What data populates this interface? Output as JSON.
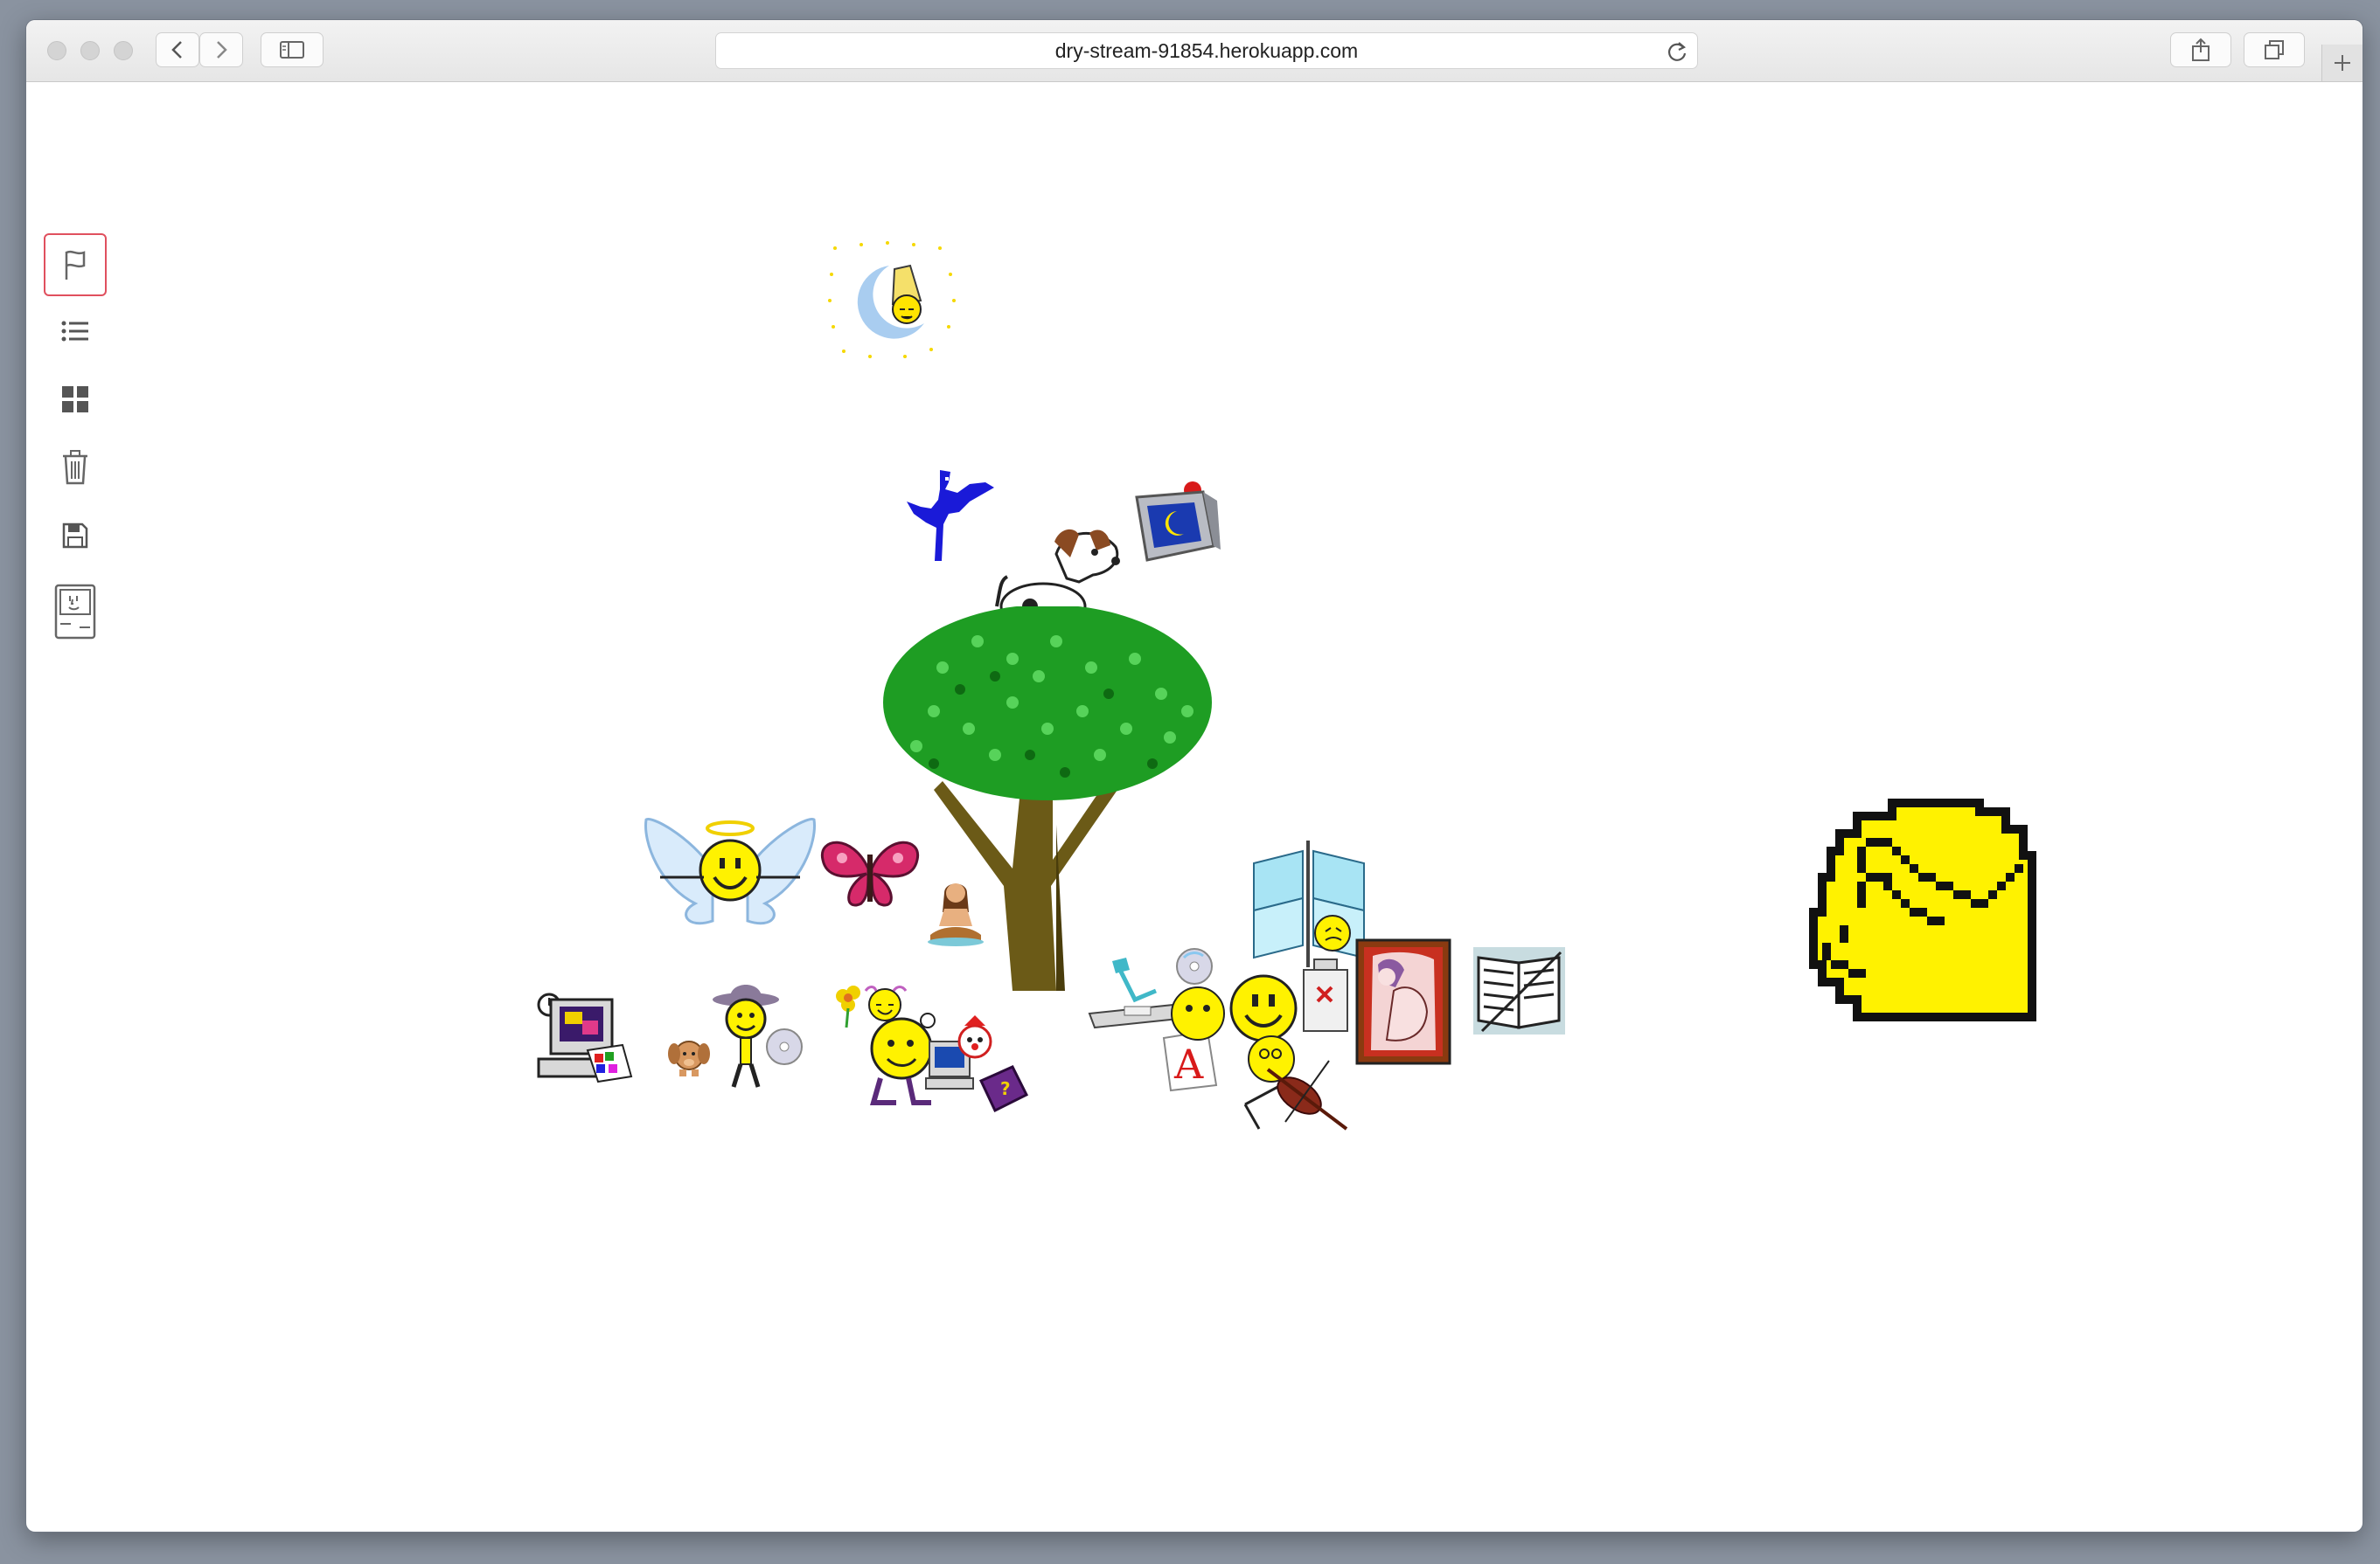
{
  "browser": {
    "url": "dry-stream-91854.herokuapp.com",
    "toolbar_icons": [
      "back-icon",
      "forward-icon",
      "sidebar-toggle-icon",
      "reload-icon",
      "share-icon",
      "tabs-overview-icon",
      "new-tab-icon"
    ]
  },
  "sidebar": {
    "active_tool": "flag",
    "tools": [
      {
        "name": "flag",
        "icon": "flag-icon"
      },
      {
        "name": "list",
        "icon": "list-icon"
      },
      {
        "name": "grid",
        "icon": "grid-icon"
      },
      {
        "name": "trash",
        "icon": "trash-icon"
      },
      {
        "name": "save",
        "icon": "save-icon"
      },
      {
        "name": "mac",
        "icon": "classic-mac-icon"
      }
    ]
  },
  "stickers": [
    "sleeping-moon",
    "blue-bird",
    "dog",
    "tv-moon",
    "tree",
    "angel-smiley",
    "butterfly",
    "meditating-woman",
    "computer-palette",
    "small-dog",
    "cowboy-smiley",
    "flower-smiley",
    "cd",
    "smiley-flower-hair",
    "computer-smiley",
    "clown",
    "purple-book",
    "desk-lamp",
    "letter-a",
    "cd-smiley",
    "big-smiley",
    "violin-smiley",
    "windmill",
    "smiley-bottle",
    "framed-painting",
    "book-pattern",
    "pixel-fist"
  ],
  "colors": {
    "sidebar_active_border": "#e0505e",
    "tree_leaves": "#1e9d23",
    "tree_trunk": "#6b5a17",
    "bird": "#1a1ad8",
    "smiley_yellow": "#fff200"
  }
}
